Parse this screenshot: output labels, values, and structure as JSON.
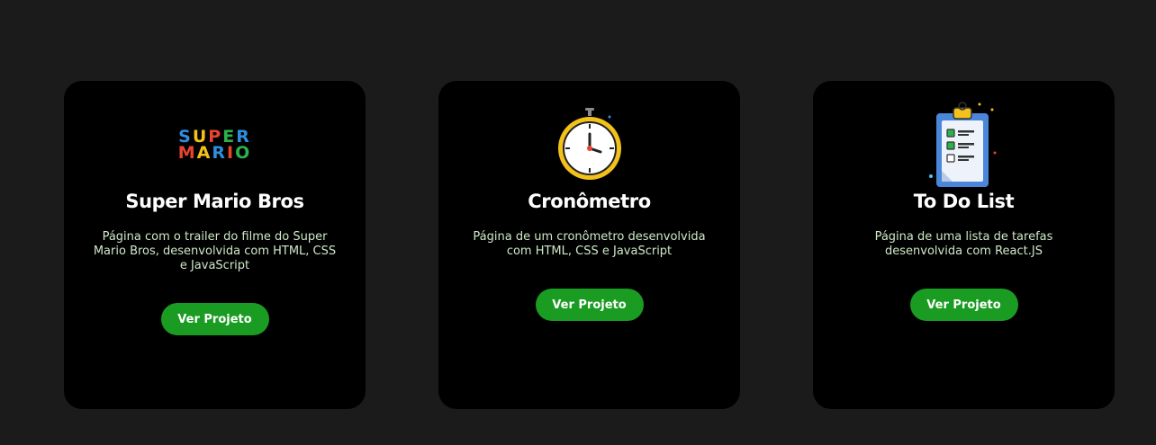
{
  "projects": [
    {
      "title": "Super Mario Bros",
      "description": "Página com o trailer do filme do Super Mario Bros, desenvolvida com HTML, CSS e JavaScript",
      "button_label": "Ver Projeto",
      "icon": "super-mario-logo",
      "logo_text": {
        "row1": [
          "S",
          "U",
          "P",
          "E",
          "R"
        ],
        "row2": [
          "M",
          "A",
          "R",
          "I",
          "O"
        ]
      },
      "logo_colors": {
        "row1": [
          "#2e8ee0",
          "#f2c21b",
          "#e8442e",
          "#2bb24c",
          "#2e8ee0"
        ],
        "row2": [
          "#e8442e",
          "#f2c21b",
          "#2e8ee0",
          "#e8442e",
          "#2bb24c"
        ]
      }
    },
    {
      "title": "Cronômetro",
      "description": "Página de um cronômetro desenvolvida com HTML, CSS e JavaScript",
      "button_label": "Ver Projeto",
      "icon": "stopwatch-icon"
    },
    {
      "title": "To Do List",
      "description": "Página de uma lista de tarefas desenvolvida com React.JS",
      "button_label": "Ver Projeto",
      "icon": "clipboard-checklist-icon"
    }
  ],
  "colors": {
    "page_background": "#1b1b1b",
    "card_background": "#000000",
    "button": "#1a9c22",
    "title": "#ffffff",
    "description": "#cfe9c8"
  }
}
